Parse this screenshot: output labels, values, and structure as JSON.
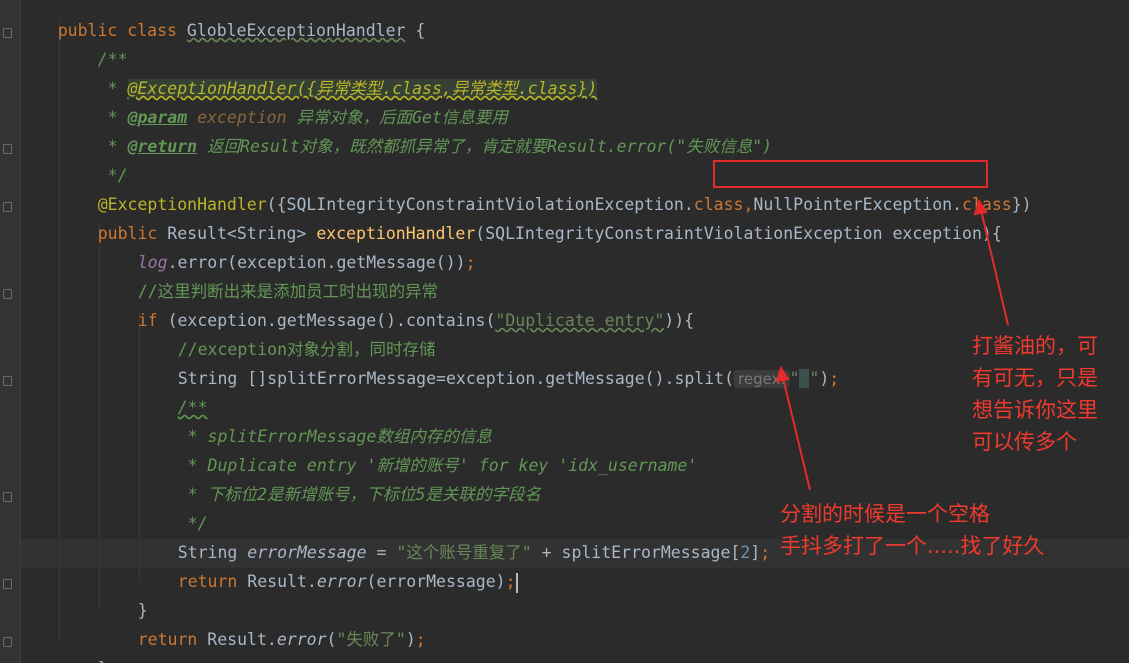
{
  "editor": {
    "lines": {
      "l0": {
        "a": "public class ",
        "b": "GlobleExceptionHandler",
        "c": " {"
      },
      "l1": "/**",
      "l2": {
        "star": " * ",
        "tag": "@ExceptionHandler({异常类型.class,异常类型.class})"
      },
      "l3": {
        "star": " * ",
        "tag": "@param",
        "val": " exception",
        "text": " 异常对象，后面Get信息要用"
      },
      "l4": {
        "star": " * ",
        "tag": "@return",
        "text": " 返回Result对象，既然都抓异常了，肯定就要Result.error(\"失败信息\")"
      },
      "l5": " */",
      "l6": {
        "ann": "@ExceptionHandler",
        "a": "({SQLIntegrityConstraintViolationException.",
        "k1": "class",
        "comma": ",",
        "b": "NullPointerException.",
        "k2": "class",
        "c": "})"
      },
      "l7": {
        "kw": "public ",
        "a": "Result<String> ",
        "fn": "exceptionHandler",
        "b": "(SQLIntegrityConstraintViolationException exception){"
      },
      "l8": {
        "st": "log",
        "a": ".error(exception.getMessage())",
        "semi": ";"
      },
      "l9": "//这里判断出来是添加员工时出现的异常",
      "l10": {
        "kw": "if ",
        "a": "(exception.getMessage().contains(",
        "str": "\"Duplicate entry\"",
        "b": ")){"
      },
      "l11": "//exception对象分割，同时存储",
      "l12": {
        "a": "String []splitErrorMessage=exception.getMessage().split(",
        "hint": "regex:",
        "q1": "\"",
        "sp": " ",
        "q2": "\"",
        "b": ")",
        "semi": ";"
      },
      "l13": "/**",
      "l14": " * splitErrorMessage数组内存的信息",
      "l15": " * Duplicate entry '新增的账号' for key 'idx_username'",
      "l16": " * 下标位2是新增账号，下标位5是关联的字段名",
      "l17": " */",
      "l18": {
        "a": "String ",
        "it": "errorMessage",
        "b": " = ",
        "str": "\"这个账号重复了\"",
        "c": " + splitErrorMessage[",
        "num": "2",
        "d": "]",
        "semi": ";"
      },
      "l19": {
        "kw": "return ",
        "a": "Result.",
        "it": "error",
        "b": "(errorMessage)",
        "semi": ";"
      },
      "l20": "}",
      "l21": {
        "kw": "return ",
        "a": "Result.",
        "it": "error",
        "b": "(",
        "str": "\"失败了\"",
        "c": ")",
        "semi": ";"
      },
      "l22": "}"
    }
  },
  "annotations": {
    "note_right": "打酱油的，可\n有可无，只是\n想告诉你这里\n可以传多个",
    "note_bottom": "分割的时候是一个空格\n手抖多打了一个.....找了好久",
    "color": "#f03a2e"
  }
}
